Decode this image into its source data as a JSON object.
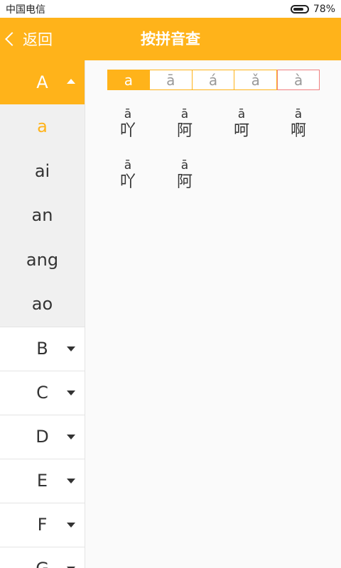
{
  "status": {
    "carrier": "中国电信",
    "battery": "78%"
  },
  "header": {
    "back_label": "返回",
    "title": "按拼音查"
  },
  "sidebar": {
    "active_letter": "A",
    "syllables": [
      "a",
      "ai",
      "an",
      "ang",
      "ao"
    ],
    "letters": [
      "B",
      "C",
      "D",
      "E",
      "F",
      "G"
    ]
  },
  "tones": [
    "a",
    "ā",
    "á",
    "ǎ",
    "à"
  ],
  "characters": [
    {
      "pinyin": "ā",
      "char": "吖"
    },
    {
      "pinyin": "ā",
      "char": "阿"
    },
    {
      "pinyin": "ā",
      "char": "呵"
    },
    {
      "pinyin": "ā",
      "char": "啊"
    },
    {
      "pinyin": "ā",
      "char": "吖"
    },
    {
      "pinyin": "ā",
      "char": "阿"
    }
  ],
  "colors": {
    "accent": "#ffb31a"
  }
}
